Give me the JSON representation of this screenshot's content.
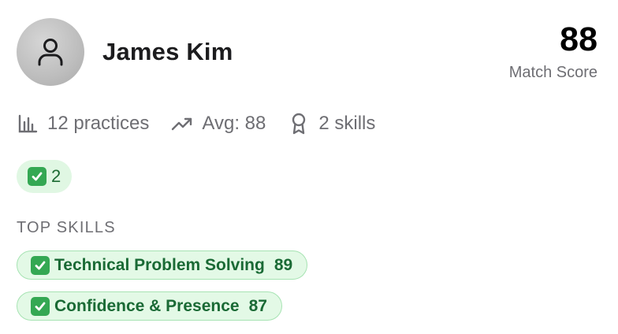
{
  "profile": {
    "name": "James Kim",
    "avatar_icon": "person-icon"
  },
  "score": {
    "value": "88",
    "label": "Match Score"
  },
  "stats": [
    {
      "icon": "bar-chart-icon",
      "text": "12 practices"
    },
    {
      "icon": "trending-up-icon",
      "text": "Avg: 88"
    },
    {
      "icon": "award-icon",
      "text": "2 skills"
    }
  ],
  "badge": {
    "icon": "check-mark-emoji",
    "count": "2"
  },
  "top_skills": {
    "title": "TOP SKILLS",
    "items": [
      {
        "icon": "check-mark-emoji",
        "name": "Technical Problem Solving",
        "score": "89"
      },
      {
        "icon": "check-mark-emoji",
        "name": "Confidence & Presence",
        "score": "87"
      }
    ]
  },
  "colors": {
    "chip_background": "#e3f9e6",
    "chip_border": "#a6e3b2",
    "chip_text": "#1a6a35",
    "check_green": "#34a853",
    "muted_text": "#6e6e73"
  }
}
